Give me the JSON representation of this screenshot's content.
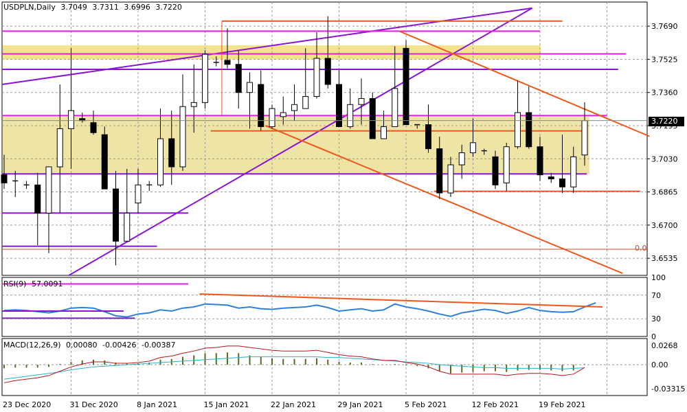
{
  "header": {
    "symbol": "USDPLN,Daily",
    "open": "3.7049",
    "high": "3.7311",
    "low": "3.6996",
    "close": "3.7220",
    "tool_label": "0.0"
  },
  "price_badge": "3.7220",
  "rsi": {
    "label": "RSI(9)",
    "value": "57.0091",
    "ticks": [
      "100",
      "70",
      "30",
      "0"
    ],
    "last": 57.0
  },
  "macd": {
    "label": "MACD(12,26,9)",
    "values": [
      "0.00080",
      "-0.00426",
      "-0.00387"
    ],
    "ticks": [
      "0.0268",
      "0.00",
      "-0.03315"
    ]
  },
  "colors": {
    "bull_fill": "#ffffff",
    "bear_fill": "#000000",
    "support_zone": "#eee4a6",
    "resistance_zone": "#f3e38c",
    "magenta": "#e11be1",
    "purple": "#8a14d6",
    "orange": "#f0571a",
    "rsi_line": "#2f7fdc",
    "macd_line": "#b8141a",
    "signal_line": "#20b5c8"
  },
  "chart_data": {
    "type": "candlestick",
    "symbol": "USDPLN",
    "timeframe": "Daily",
    "ylim": [
      3.645,
      3.781
    ],
    "price_ticks": [
      "3.7690",
      "3.7525",
      "3.7360",
      "3.7195",
      "3.7030",
      "3.6865",
      "3.6700",
      "3.6535"
    ],
    "x_labels": [
      "23 Dec 2020",
      "31 Dec 2020",
      "8 Jan 2021",
      "15 Jan 2021",
      "22 Jan 2021",
      "29 Jan 2021",
      "5 Feb 2021",
      "12 Feb 2021",
      "19 Feb 2021"
    ],
    "candles": [
      {
        "o": 3.695,
        "h": 3.705,
        "l": 3.688,
        "c": 3.691
      },
      {
        "o": 3.692,
        "h": 3.697,
        "l": 3.684,
        "c": 3.692
      },
      {
        "o": 3.69,
        "h": 3.692,
        "l": 3.688,
        "c": 3.69
      },
      {
        "o": 3.69,
        "h": 3.696,
        "l": 3.66,
        "c": 3.676
      },
      {
        "o": 3.676,
        "h": 3.698,
        "l": 3.656,
        "c": 3.699
      },
      {
        "o": 3.699,
        "h": 3.74,
        "l": 3.676,
        "c": 3.718
      },
      {
        "o": 3.718,
        "h": 3.758,
        "l": 3.698,
        "c": 3.727
      },
      {
        "o": 3.723,
        "h": 3.726,
        "l": 3.721,
        "c": 3.722
      },
      {
        "o": 3.721,
        "h": 3.727,
        "l": 3.715,
        "c": 3.716
      },
      {
        "o": 3.715,
        "h": 3.719,
        "l": 3.688,
        "c": 3.688
      },
      {
        "o": 3.688,
        "h": 3.697,
        "l": 3.65,
        "c": 3.662
      },
      {
        "o": 3.662,
        "h": 3.698,
        "l": 3.665,
        "c": 3.676
      },
      {
        "o": 3.681,
        "h": 3.698,
        "l": 3.676,
        "c": 3.69
      },
      {
        "o": 3.69,
        "h": 3.692,
        "l": 3.687,
        "c": 3.69
      },
      {
        "o": 3.69,
        "h": 3.728,
        "l": 3.689,
        "c": 3.713
      },
      {
        "o": 3.713,
        "h": 3.727,
        "l": 3.69,
        "c": 3.699
      },
      {
        "o": 3.699,
        "h": 3.745,
        "l": 3.697,
        "c": 3.729
      },
      {
        "o": 3.729,
        "h": 3.75,
        "l": 3.716,
        "c": 3.731
      },
      {
        "o": 3.731,
        "h": 3.757,
        "l": 3.728,
        "c": 3.755
      },
      {
        "o": 3.751,
        "h": 3.754,
        "l": 3.749,
        "c": 3.751
      },
      {
        "o": 3.752,
        "h": 3.768,
        "l": 3.748,
        "c": 3.75
      },
      {
        "o": 3.75,
        "h": 3.757,
        "l": 3.728,
        "c": 3.736
      },
      {
        "o": 3.736,
        "h": 3.746,
        "l": 3.718,
        "c": 3.741
      },
      {
        "o": 3.74,
        "h": 3.747,
        "l": 3.717,
        "c": 3.719
      },
      {
        "o": 3.719,
        "h": 3.73,
        "l": 3.718,
        "c": 3.728
      },
      {
        "o": 3.724,
        "h": 3.734,
        "l": 3.72,
        "c": 3.726
      },
      {
        "o": 3.727,
        "h": 3.74,
        "l": 3.722,
        "c": 3.73
      },
      {
        "o": 3.728,
        "h": 3.758,
        "l": 3.728,
        "c": 3.734
      },
      {
        "o": 3.734,
        "h": 3.766,
        "l": 3.733,
        "c": 3.753
      },
      {
        "o": 3.753,
        "h": 3.774,
        "l": 3.738,
        "c": 3.74
      },
      {
        "o": 3.74,
        "h": 3.748,
        "l": 3.719,
        "c": 3.719
      },
      {
        "o": 3.719,
        "h": 3.738,
        "l": 3.718,
        "c": 3.73
      },
      {
        "o": 3.73,
        "h": 3.743,
        "l": 3.72,
        "c": 3.733
      },
      {
        "o": 3.733,
        "h": 3.736,
        "l": 3.713,
        "c": 3.713
      },
      {
        "o": 3.713,
        "h": 3.727,
        "l": 3.714,
        "c": 3.719
      },
      {
        "o": 3.719,
        "h": 3.759,
        "l": 3.719,
        "c": 3.738
      },
      {
        "o": 3.758,
        "h": 3.762,
        "l": 3.72,
        "c": 3.72
      },
      {
        "o": 3.72,
        "h": 3.72,
        "l": 3.718,
        "c": 3.72
      },
      {
        "o": 3.72,
        "h": 3.73,
        "l": 3.706,
        "c": 3.708
      },
      {
        "o": 3.708,
        "h": 3.714,
        "l": 3.683,
        "c": 3.686
      },
      {
        "o": 3.686,
        "h": 3.704,
        "l": 3.684,
        "c": 3.7
      },
      {
        "o": 3.7,
        "h": 3.71,
        "l": 3.693,
        "c": 3.706
      },
      {
        "o": 3.706,
        "h": 3.723,
        "l": 3.704,
        "c": 3.711
      },
      {
        "o": 3.707,
        "h": 3.708,
        "l": 3.705,
        "c": 3.707
      },
      {
        "o": 3.704,
        "h": 3.707,
        "l": 3.688,
        "c": 3.69
      },
      {
        "o": 3.691,
        "h": 3.711,
        "l": 3.687,
        "c": 3.709
      },
      {
        "o": 3.709,
        "h": 3.742,
        "l": 3.708,
        "c": 3.726
      },
      {
        "o": 3.726,
        "h": 3.739,
        "l": 3.708,
        "c": 3.709
      },
      {
        "o": 3.709,
        "h": 3.714,
        "l": 3.692,
        "c": 3.695
      },
      {
        "o": 3.694,
        "h": 3.696,
        "l": 3.691,
        "c": 3.693
      },
      {
        "o": 3.693,
        "h": 3.715,
        "l": 3.686,
        "c": 3.689
      },
      {
        "o": 3.689,
        "h": 3.709,
        "l": 3.686,
        "c": 3.704
      },
      {
        "o": 3.7049,
        "h": 3.7311,
        "l": 3.6996,
        "c": 3.722
      }
    ],
    "rsi_series": [
      44,
      45,
      44,
      42,
      40,
      43,
      48,
      49,
      48,
      42,
      35,
      33,
      38,
      40,
      45,
      43,
      48,
      50,
      55,
      54,
      53,
      48,
      50,
      47,
      46,
      48,
      49,
      50,
      53,
      49,
      43,
      45,
      47,
      43,
      45,
      55,
      50,
      47,
      43,
      38,
      34,
      40,
      43,
      46,
      44,
      39,
      43,
      49,
      44,
      42,
      41,
      42,
      50,
      57
    ],
    "macd_hist": [
      -0.005,
      -0.004,
      -0.004,
      -0.004,
      -0.003,
      0.001,
      0.004,
      0.006,
      0.007,
      0.006,
      0.003,
      0.002,
      0.002,
      0.003,
      0.007,
      0.008,
      0.011,
      0.013,
      0.016,
      0.016,
      0.017,
      0.016,
      0.013,
      0.011,
      0.009,
      0.008,
      0.008,
      0.008,
      0.009,
      0.007,
      0.004,
      0.003,
      0.003,
      0.001,
      0.0,
      0.001,
      -0.001,
      -0.002,
      -0.005,
      -0.009,
      -0.012,
      -0.011,
      -0.01,
      -0.009,
      -0.009,
      -0.01,
      -0.008,
      -0.007,
      -0.007,
      -0.008,
      -0.009,
      -0.008,
      0.0008
    ],
    "macd_signal": [
      -0.02,
      -0.018,
      -0.016,
      -0.014,
      -0.012,
      -0.01,
      -0.007,
      -0.005,
      -0.003,
      -0.002,
      -0.001,
      0.0,
      0.001,
      0.002,
      0.003,
      0.004,
      0.005,
      0.006,
      0.007,
      0.008,
      0.009,
      0.01,
      0.011,
      0.011,
      0.011,
      0.011,
      0.011,
      0.011,
      0.011,
      0.01,
      0.01,
      0.009,
      0.008,
      0.007,
      0.006,
      0.005,
      0.004,
      0.003,
      0.002,
      0.0,
      -0.001,
      -0.002,
      -0.003,
      -0.004,
      -0.004,
      -0.005,
      -0.005,
      -0.005,
      -0.005,
      -0.005,
      -0.006,
      -0.005,
      -0.00426
    ],
    "macd_main": [
      -0.025,
      -0.022,
      -0.02,
      -0.018,
      -0.015,
      -0.009,
      -0.003,
      0.001,
      0.004,
      0.004,
      0.002,
      0.002,
      0.003,
      0.005,
      0.01,
      0.012,
      0.016,
      0.019,
      0.023,
      0.024,
      0.026,
      0.026,
      0.024,
      0.022,
      0.02,
      0.019,
      0.019,
      0.019,
      0.02,
      0.017,
      0.014,
      0.012,
      0.011,
      0.008,
      0.006,
      0.006,
      0.003,
      0.001,
      -0.003,
      -0.009,
      -0.013,
      -0.013,
      -0.013,
      -0.013,
      -0.013,
      -0.015,
      -0.013,
      -0.012,
      -0.012,
      -0.013,
      -0.015,
      -0.013,
      -0.00387
    ]
  }
}
